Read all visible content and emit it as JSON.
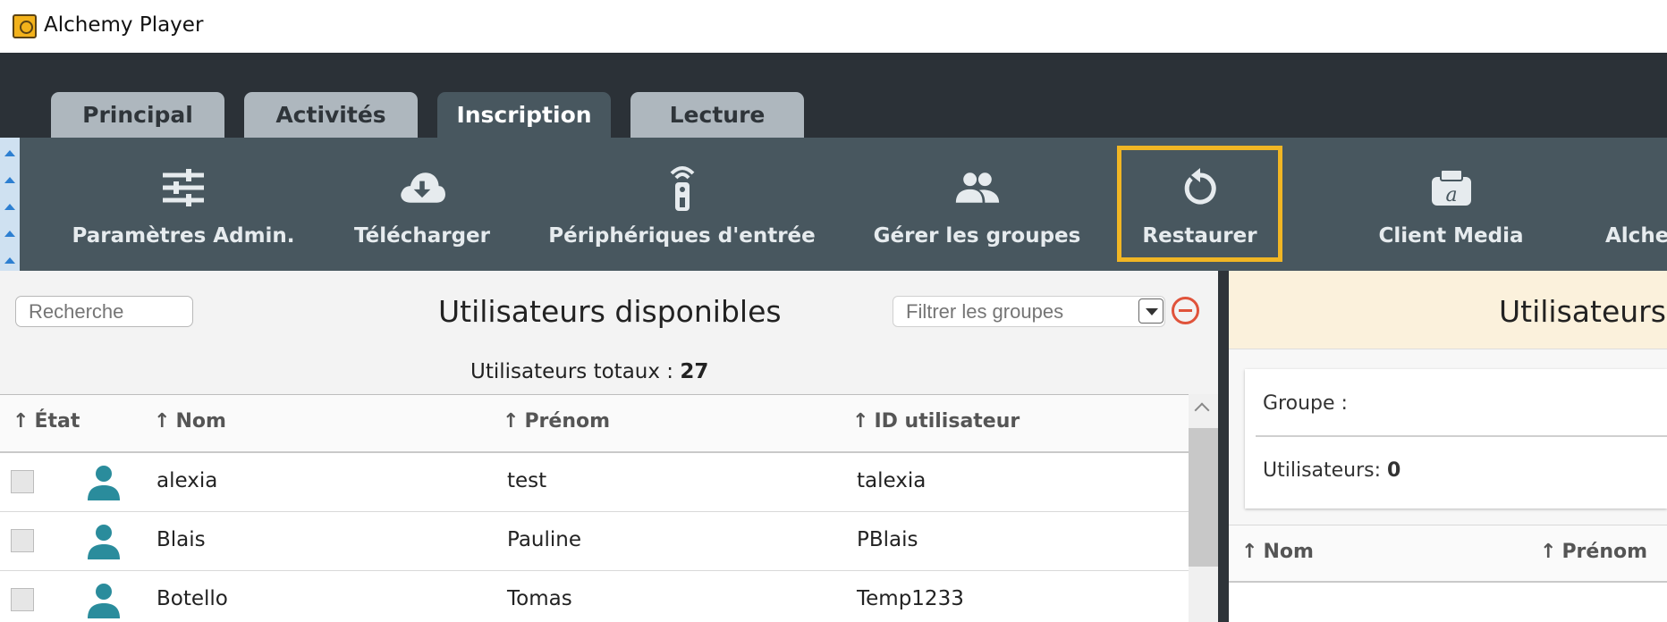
{
  "window": {
    "title": "Alchemy Player"
  },
  "tabs": [
    {
      "label": "Principal"
    },
    {
      "label": "Activités"
    },
    {
      "label": "Inscription"
    },
    {
      "label": "Lecture"
    }
  ],
  "active_tab": "Inscription",
  "toolbar": {
    "items": [
      {
        "label": "Paramètres Admin.",
        "icon": "sliders-icon"
      },
      {
        "label": "Télécharger",
        "icon": "cloud-download-icon"
      },
      {
        "label": "Périphériques d'entrée",
        "icon": "remote-control-icon"
      },
      {
        "label": "Gérer les groupes",
        "icon": "group-icon"
      },
      {
        "label": "Restaurer",
        "icon": "restore-icon"
      },
      {
        "label": "Client Media",
        "icon": "media-client-icon"
      },
      {
        "label": "Alcher",
        "icon": ""
      }
    ],
    "highlighted": "Restaurer",
    "highlight_color": "#F1B624"
  },
  "available": {
    "search_placeholder": "Recherche",
    "title": "Utilisateurs disponibles",
    "filter_placeholder": "Filtrer les groupes",
    "total_label": "Utilisateurs totaux :",
    "total_value": "27",
    "columns": [
      "État",
      "Nom",
      "Prénom",
      "ID utilisateur"
    ],
    "rows": [
      {
        "nom": "alexia",
        "prenom": "test",
        "id": "talexia"
      },
      {
        "nom": "Blais",
        "prenom": "Pauline",
        "id": "PBlais"
      },
      {
        "nom": "Botello",
        "prenom": "Tomas",
        "id": "Temp1233"
      }
    ]
  },
  "assigned": {
    "title": "Utilisateurs",
    "group_label": "Groupe :",
    "users_label": "Utilisateurs:",
    "users_value": "0",
    "columns": [
      "Nom",
      "Prénom"
    ]
  },
  "colors": {
    "tabbar_bg": "#2B3137",
    "toolbar_bg": "#48575F",
    "user_icon": "#2A8C9C",
    "remove_icon": "#E0533B"
  }
}
